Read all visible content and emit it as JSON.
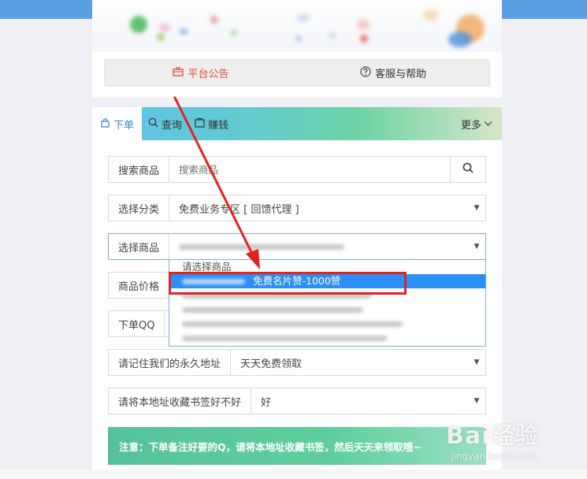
{
  "notice_bar": {
    "announcement_label": "平台公告",
    "help_label": "客服与帮助"
  },
  "tabs": {
    "order": "下单",
    "query": "查询",
    "earn": "赚钱",
    "more": "更多"
  },
  "form": {
    "search_label": "搜索商品",
    "search_placeholder": "搜索商品",
    "category_label": "选择分类",
    "category_value": "免费业务专区 [ 回馈代理 ]",
    "product_label": "选择商品",
    "price_label": "商品价格",
    "qq_label": "下单QQ",
    "address_label": "请记住我们的永久地址",
    "address_value": "天天免费领取",
    "bookmark_label": "请将本地址收藏书签好不好",
    "bookmark_value": "好"
  },
  "dropdown": {
    "placeholder": "请选择商品",
    "selected_text": "免费名片赞-1000赞"
  },
  "note": "注意：下单备注好要的Q，请将本地址收藏书签，然后天天来领取哦~",
  "watermark": {
    "main": "Bai经验",
    "sub": "jingyan.baidu.com"
  },
  "colors": {
    "accent": "#2f89d8",
    "announcement": "#e64a3b",
    "selection": "#2a8ff7",
    "highlight": "#e3231f",
    "note": "#56c29d"
  }
}
